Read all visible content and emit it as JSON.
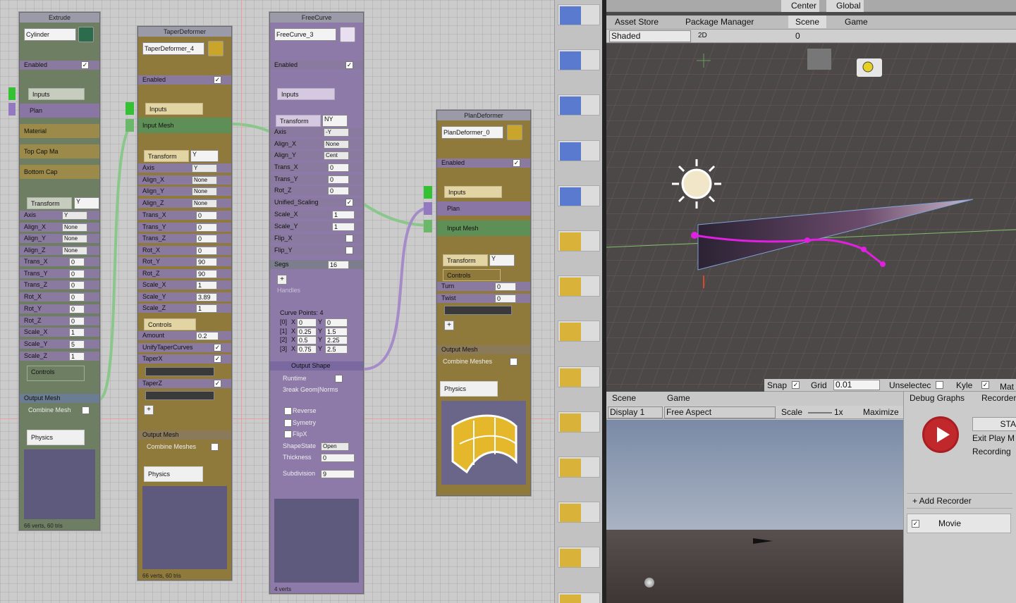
{
  "colors": {
    "extrude": "#6d7e63",
    "taper": "#8f7a3c",
    "freecurve": "#8e7aa8",
    "plan": "#8f7a3c",
    "wire_green": "#8ac78a",
    "wire_purple": "#a58bc8",
    "spline": "#e020e0"
  },
  "extrude": {
    "title": "Extrude",
    "name": "Cylinder",
    "enabled": "Enabled",
    "inputs": "Inputs",
    "plan": "Plan",
    "material": "Material",
    "topcap": "Top Cap Ma",
    "bottomcap": "Bottom Cap",
    "transform": "Transform",
    "transform_val": "Y",
    "axis": "Axis",
    "axis_val": "Y",
    "align_x": "Align_X",
    "align_x_val": "None",
    "align_y": "Align_Y",
    "align_y_val": "None",
    "align_z": "Align_Z",
    "align_z_val": "None",
    "rows": [
      {
        "l": "Trans_X",
        "v": "0"
      },
      {
        "l": "Trans_Y",
        "v": "0"
      },
      {
        "l": "Trans_Z",
        "v": "0"
      },
      {
        "l": "Rot_X",
        "v": "0"
      },
      {
        "l": "Rot_Y",
        "v": "0"
      },
      {
        "l": "Rot_Z",
        "v": "0"
      },
      {
        "l": "Scale_X",
        "v": "1"
      },
      {
        "l": "Scale_Y",
        "v": "5"
      },
      {
        "l": "Scale_Z",
        "v": "1"
      }
    ],
    "controls": "Controls",
    "output": "Output Mesh",
    "combine": "Combine Mesh",
    "physics": "Physics",
    "stats": "66 verts, 60 tris"
  },
  "taper": {
    "title": "TaperDeformer",
    "name": "TaperDeformer_4",
    "enabled": "Enabled",
    "inputs": "Inputs",
    "inputmesh": "Input Mesh",
    "transform": "Transform",
    "transform_val": "Y",
    "axis": "Axis",
    "axis_val": "Y",
    "align_x": "Align_X",
    "align_x_val": "None",
    "align_y": "Align_Y",
    "align_y_val": "None",
    "align_z": "Align_Z",
    "align_z_val": "None",
    "rows": [
      {
        "l": "Trans_X",
        "v": "0"
      },
      {
        "l": "Trans_Y",
        "v": "0"
      },
      {
        "l": "Trans_Z",
        "v": "0"
      },
      {
        "l": "Rot_X",
        "v": "0"
      },
      {
        "l": "Rot_Y",
        "v": "90"
      },
      {
        "l": "Rot_Z",
        "v": "90"
      },
      {
        "l": "Scale_X",
        "v": "1"
      },
      {
        "l": "Scale_Y",
        "v": "3.89"
      },
      {
        "l": "Scale_Z",
        "v": "1"
      }
    ],
    "controls": "Controls",
    "amount": "Amount",
    "amount_val": "0.2",
    "unify": "UnifyTaperCurves",
    "taperx": "TaperX",
    "taperz": "TaperZ",
    "output": "Output Mesh",
    "combine": "Combine Meshes",
    "physics": "Physics",
    "stats": "66 verts, 60 tris"
  },
  "freecurve": {
    "title": "FreeCurve",
    "name": "FreeCurve_3",
    "enabled": "Enabled",
    "inputs": "Inputs",
    "transform": "Transform",
    "transform_val": "NY",
    "axis": "Axis",
    "axis_val": "-Y",
    "align_x": "Align_X",
    "align_x_val": "None",
    "align_y": "Align_Y",
    "align_y_val": "Cent",
    "rows": [
      {
        "l": "Trans_X",
        "v": "0"
      },
      {
        "l": "Trans_Y",
        "v": "0"
      },
      {
        "l": "Rot_Z",
        "v": "0"
      }
    ],
    "unified": "Unified_Scaling",
    "scalex": "Scale_X",
    "scalex_val": "1",
    "scaley": "Scale_Y",
    "scaley_val": "1",
    "flipx": "Flip_X",
    "flipy": "Flip_Y",
    "segs": "Segs",
    "segs_val": "16",
    "handles": "Handles",
    "curve_points": "Curve Points: 4",
    "points": [
      {
        "i": "[0]",
        "x": "0",
        "y": "0"
      },
      {
        "i": "[1]",
        "x": "0.25",
        "y": "1.5"
      },
      {
        "i": "[2]",
        "x": "0.5",
        "y": "2.25"
      },
      {
        "i": "[3]",
        "x": "0.75",
        "y": "2.5"
      }
    ],
    "output_shape": "Output Shape",
    "runtime": "Runtime",
    "break": "3reak Geom|Norms",
    "reverse": "Reverse",
    "symetry": "Symetry",
    "flipx2": "FlipX",
    "shapestate": "ShapeState",
    "shapestate_val": "Open",
    "thickness": "Thickness",
    "thickness_val": "0",
    "subdivision": "Subdivision",
    "subdivision_val": "9",
    "stats": "4 verts"
  },
  "plan": {
    "title": "PlanDeformer",
    "name": "PlanDeformer_0",
    "enabled": "Enabled",
    "inputs": "Inputs",
    "plan": "Plan",
    "inputmesh": "Input Mesh",
    "transform": "Transform",
    "transform_val": "Y",
    "controls": "Controls",
    "turn": "Turn",
    "turn_val": "0",
    "twist": "Twist",
    "twist_val": "0",
    "output": "Output Mesh",
    "combine": "Combine Meshes",
    "physics": "Physics"
  },
  "scene": {
    "center": "Center",
    "global": "Global",
    "tabs": [
      "Asset Store",
      "Package Manager",
      "Scene",
      "Game"
    ],
    "shaded": "Shaded",
    "mode2d": "2D",
    "hidden_count": "0",
    "snap": "Snap",
    "grid": "Grid",
    "grid_val": "0.01",
    "unselected": "Unselectec",
    "kyle": "Kyle",
    "mat": "Mat"
  },
  "game": {
    "tabs": [
      "Scene",
      "Game"
    ],
    "display": "Display 1",
    "aspect": "Free Aspect",
    "scale": "Scale",
    "scale_val": "1x",
    "maximize": "Maximize"
  },
  "recorder": {
    "tabs": [
      "Debug Graphs",
      "Recorder"
    ],
    "start": "STA",
    "exit": "Exit Play M",
    "recording": "Recording",
    "add": "+ Add Recorder",
    "movie": "Movie"
  }
}
